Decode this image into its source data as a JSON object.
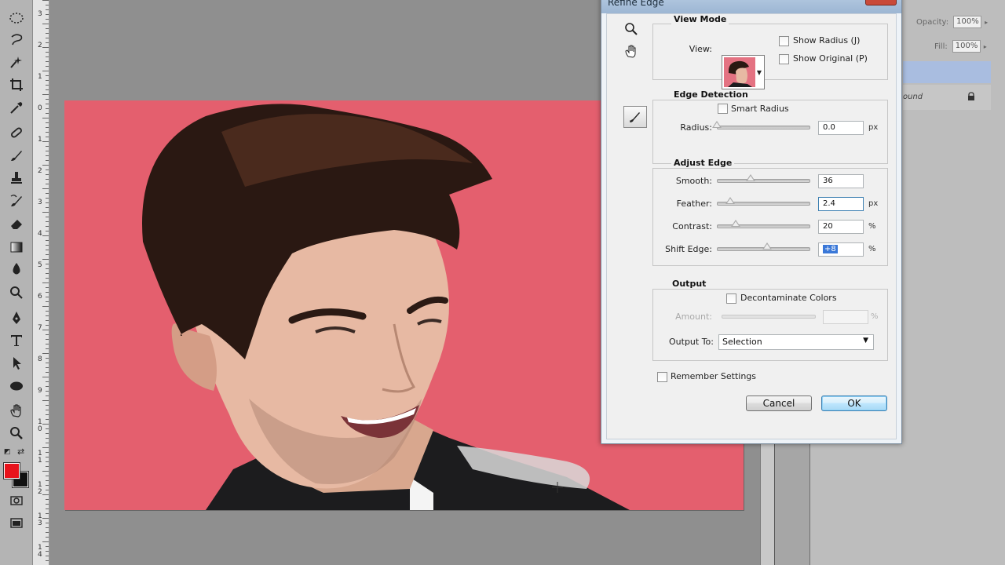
{
  "dialog": {
    "title": "Refine Edge",
    "view_mode": {
      "title": "View Mode",
      "view_label": "View:",
      "show_radius": {
        "label": "Show Radius (J)",
        "checked": false
      },
      "show_original": {
        "label": "Show Original (P)",
        "checked": false
      }
    },
    "edge_detection": {
      "title": "Edge Detection",
      "smart_radius": {
        "label": "Smart Radius",
        "checked": false
      },
      "radius": {
        "label": "Radius:",
        "value": "0.0",
        "unit": "px",
        "level": 0.0
      }
    },
    "adjust_edge": {
      "title": "Adjust Edge",
      "smooth": {
        "label": "Smooth:",
        "value": "36",
        "unit": "",
        "level": 0.36
      },
      "feather": {
        "label": "Feather:",
        "value": "2.4",
        "unit": "px",
        "level": 0.14
      },
      "contrast": {
        "label": "Contrast:",
        "value": "20",
        "unit": "%",
        "level": 0.2
      },
      "shift_edge": {
        "label": "Shift Edge:",
        "value": "+8",
        "unit": "%",
        "level": 0.54
      }
    },
    "output": {
      "title": "Output",
      "decontaminate": {
        "label": "Decontaminate Colors",
        "checked": false
      },
      "amount": {
        "label": "Amount:",
        "value": "",
        "unit": "%"
      },
      "output_to_label": "Output To:",
      "output_to_value": "Selection"
    },
    "remember": {
      "label": "Remember Settings",
      "checked": false
    },
    "cancel_label": "Cancel",
    "ok_label": "OK"
  },
  "ruler": {
    "numbers": [
      "3",
      "2",
      "1",
      "0",
      "1",
      "2",
      "3",
      "4",
      "5",
      "6",
      "7",
      "8",
      "9",
      "1\n0",
      "1\n1",
      "1\n2",
      "1\n3",
      "1\n4"
    ]
  },
  "layers_panel": {
    "opacity_label": "Opacity:",
    "opacity_value": "100%",
    "fill_label": "Fill:",
    "fill_value": "100%",
    "bg_layer_text": "ound"
  },
  "colors": {
    "foreground": "#e8121b",
    "background": "#111111",
    "photo_background": "#e45f6e",
    "dialog_accent": "#3a78d8"
  },
  "icons": [
    "marquee-icon",
    "lasso-icon",
    "quick-select-icon",
    "crop-icon",
    "eyedropper-icon",
    "healing-brush-icon",
    "brush-icon",
    "clone-stamp-icon",
    "history-brush-icon",
    "eraser-icon",
    "gradient-icon",
    "blur-icon",
    "dodge-icon",
    "pen-icon",
    "type-icon",
    "path-select-icon",
    "ellipse-shape-icon",
    "hand-icon",
    "zoom-icon",
    "quick-mask-icon",
    "screen-mode-icon",
    "lock-icon"
  ]
}
